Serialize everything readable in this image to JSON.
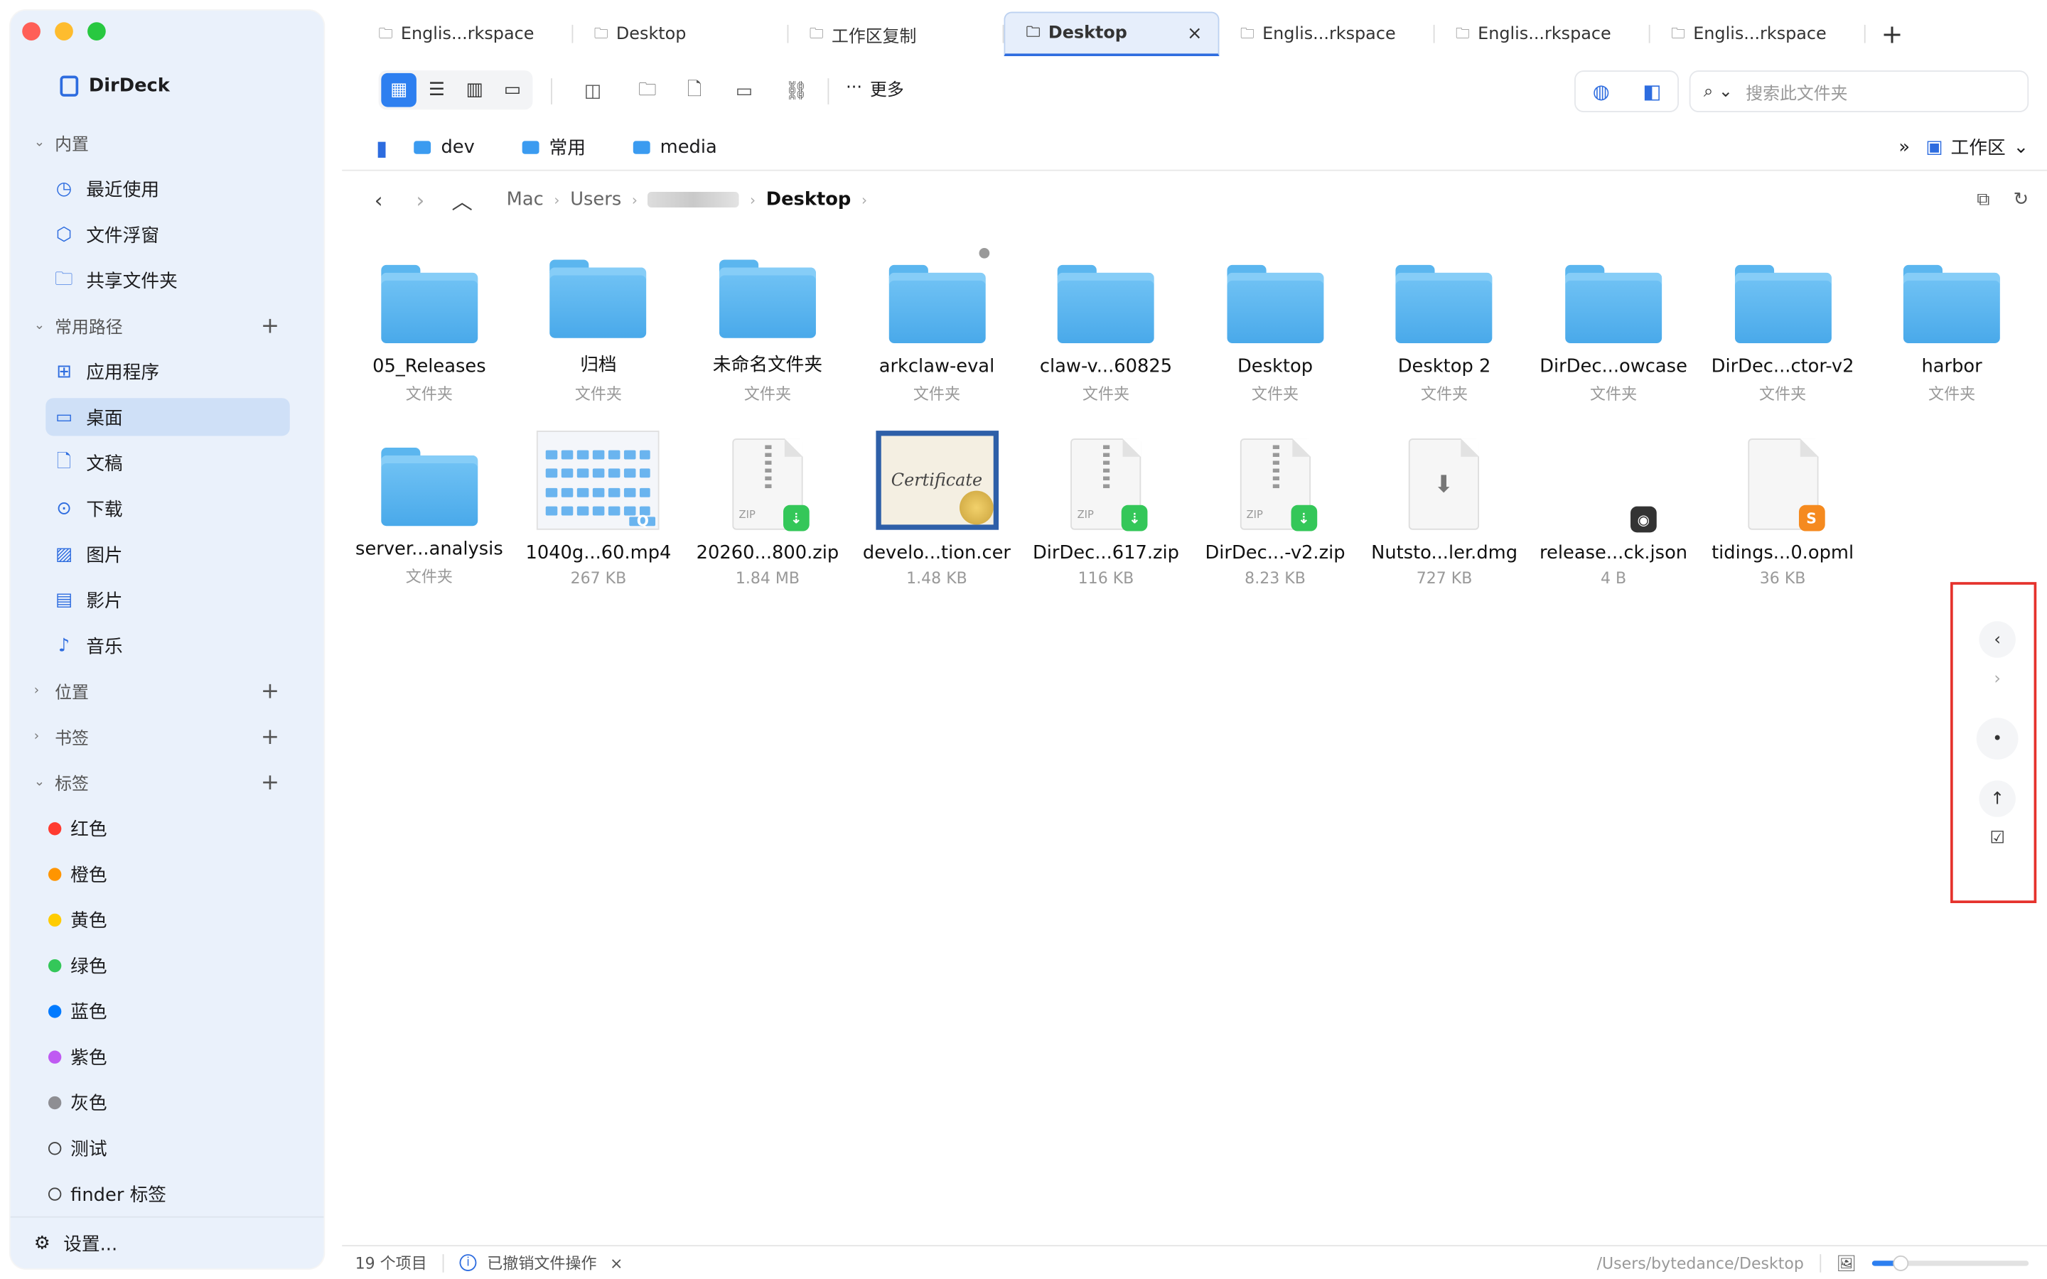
{
  "app": {
    "name": "DirDeck"
  },
  "sidebar": {
    "sections": {
      "builtin": "内置",
      "common_paths": "常用路径",
      "locations": "位置",
      "bookmarks": "书签",
      "tags": "标签"
    },
    "builtin_items": [
      {
        "label": "最近使用",
        "icon": "clock-icon"
      },
      {
        "label": "文件浮窗",
        "icon": "cube-icon"
      },
      {
        "label": "共享文件夹",
        "icon": "shared-folder-icon"
      }
    ],
    "path_items": [
      {
        "label": "应用程序",
        "icon": "apps-icon"
      },
      {
        "label": "桌面",
        "icon": "desktop-icon",
        "active": true
      },
      {
        "label": "文稿",
        "icon": "document-icon"
      },
      {
        "label": "下载",
        "icon": "download-icon"
      },
      {
        "label": "图片",
        "icon": "photo-icon"
      },
      {
        "label": "影片",
        "icon": "film-icon"
      },
      {
        "label": "音乐",
        "icon": "music-icon"
      }
    ],
    "tag_items": [
      {
        "label": "红色",
        "color": "#ff3b30"
      },
      {
        "label": "橙色",
        "color": "#ff9500"
      },
      {
        "label": "黄色",
        "color": "#ffcc00"
      },
      {
        "label": "绿色",
        "color": "#34c759"
      },
      {
        "label": "蓝色",
        "color": "#007aff"
      },
      {
        "label": "紫色",
        "color": "#bf5af2"
      },
      {
        "label": "灰色",
        "color": "#8e8e93"
      },
      {
        "label": "测试",
        "color": ""
      },
      {
        "label": "finder 标签",
        "color": ""
      }
    ],
    "settings_label": "设置..."
  },
  "tabs": [
    {
      "label": "Englis...rkspace",
      "active": false
    },
    {
      "label": "Desktop",
      "active": false
    },
    {
      "label": "工作区复制",
      "active": false
    },
    {
      "label": "Desktop",
      "active": true
    },
    {
      "label": "Englis...rkspace",
      "active": false
    },
    {
      "label": "Englis...rkspace",
      "active": false
    },
    {
      "label": "Englis...rkspace",
      "active": false
    }
  ],
  "toolbar": {
    "more_label": "更多",
    "search_placeholder": "搜索此文件夹"
  },
  "favorites": {
    "items": [
      "dev",
      "常用",
      "media"
    ],
    "workspace_label": "工作区"
  },
  "breadcrumb": {
    "items": [
      "Mac",
      "Users",
      "Desktop"
    ]
  },
  "files": [
    {
      "name": "05_Releases",
      "meta": "文件夹",
      "kind": "folder"
    },
    {
      "name": "归档",
      "meta": "文件夹",
      "kind": "folder"
    },
    {
      "name": "未命名文件夹",
      "meta": "文件夹",
      "kind": "folder"
    },
    {
      "name": "arkclaw-eval",
      "meta": "文件夹",
      "kind": "folder",
      "dot": true
    },
    {
      "name": "claw-v...60825",
      "meta": "文件夹",
      "kind": "folder"
    },
    {
      "name": "Desktop",
      "meta": "文件夹",
      "kind": "folder"
    },
    {
      "name": "Desktop 2",
      "meta": "文件夹",
      "kind": "folder"
    },
    {
      "name": "DirDec...owcase",
      "meta": "文件夹",
      "kind": "folder"
    },
    {
      "name": "DirDec...ctor-v2",
      "meta": "文件夹",
      "kind": "folder"
    },
    {
      "name": "harbor",
      "meta": "文件夹",
      "kind": "folder"
    },
    {
      "name": "server...analysis",
      "meta": "文件夹",
      "kind": "folder"
    },
    {
      "name": "1040g...60.mp4",
      "meta": "267 KB",
      "kind": "video"
    },
    {
      "name": "20260...800.zip",
      "meta": "1.84 MB",
      "kind": "zip"
    },
    {
      "name": "develo...tion.cer",
      "meta": "1.48 KB",
      "kind": "cert",
      "cert_text": "Certificate"
    },
    {
      "name": "DirDec...617.zip",
      "meta": "116 KB",
      "kind": "zip"
    },
    {
      "name": "DirDec...-v2.zip",
      "meta": "8.23 KB",
      "kind": "zip"
    },
    {
      "name": "Nutsto...ler.dmg",
      "meta": "727 KB",
      "kind": "dmg"
    },
    {
      "name": "release...ck.json",
      "meta": "4 B",
      "kind": "json"
    },
    {
      "name": "tidings...0.opml",
      "meta": "36 KB",
      "kind": "opml"
    }
  ],
  "statusbar": {
    "count": "19 个项目",
    "message": "已撤销文件操作",
    "path": "/Users/bytedance/Desktop",
    "zoom_fraction": 0.18
  }
}
